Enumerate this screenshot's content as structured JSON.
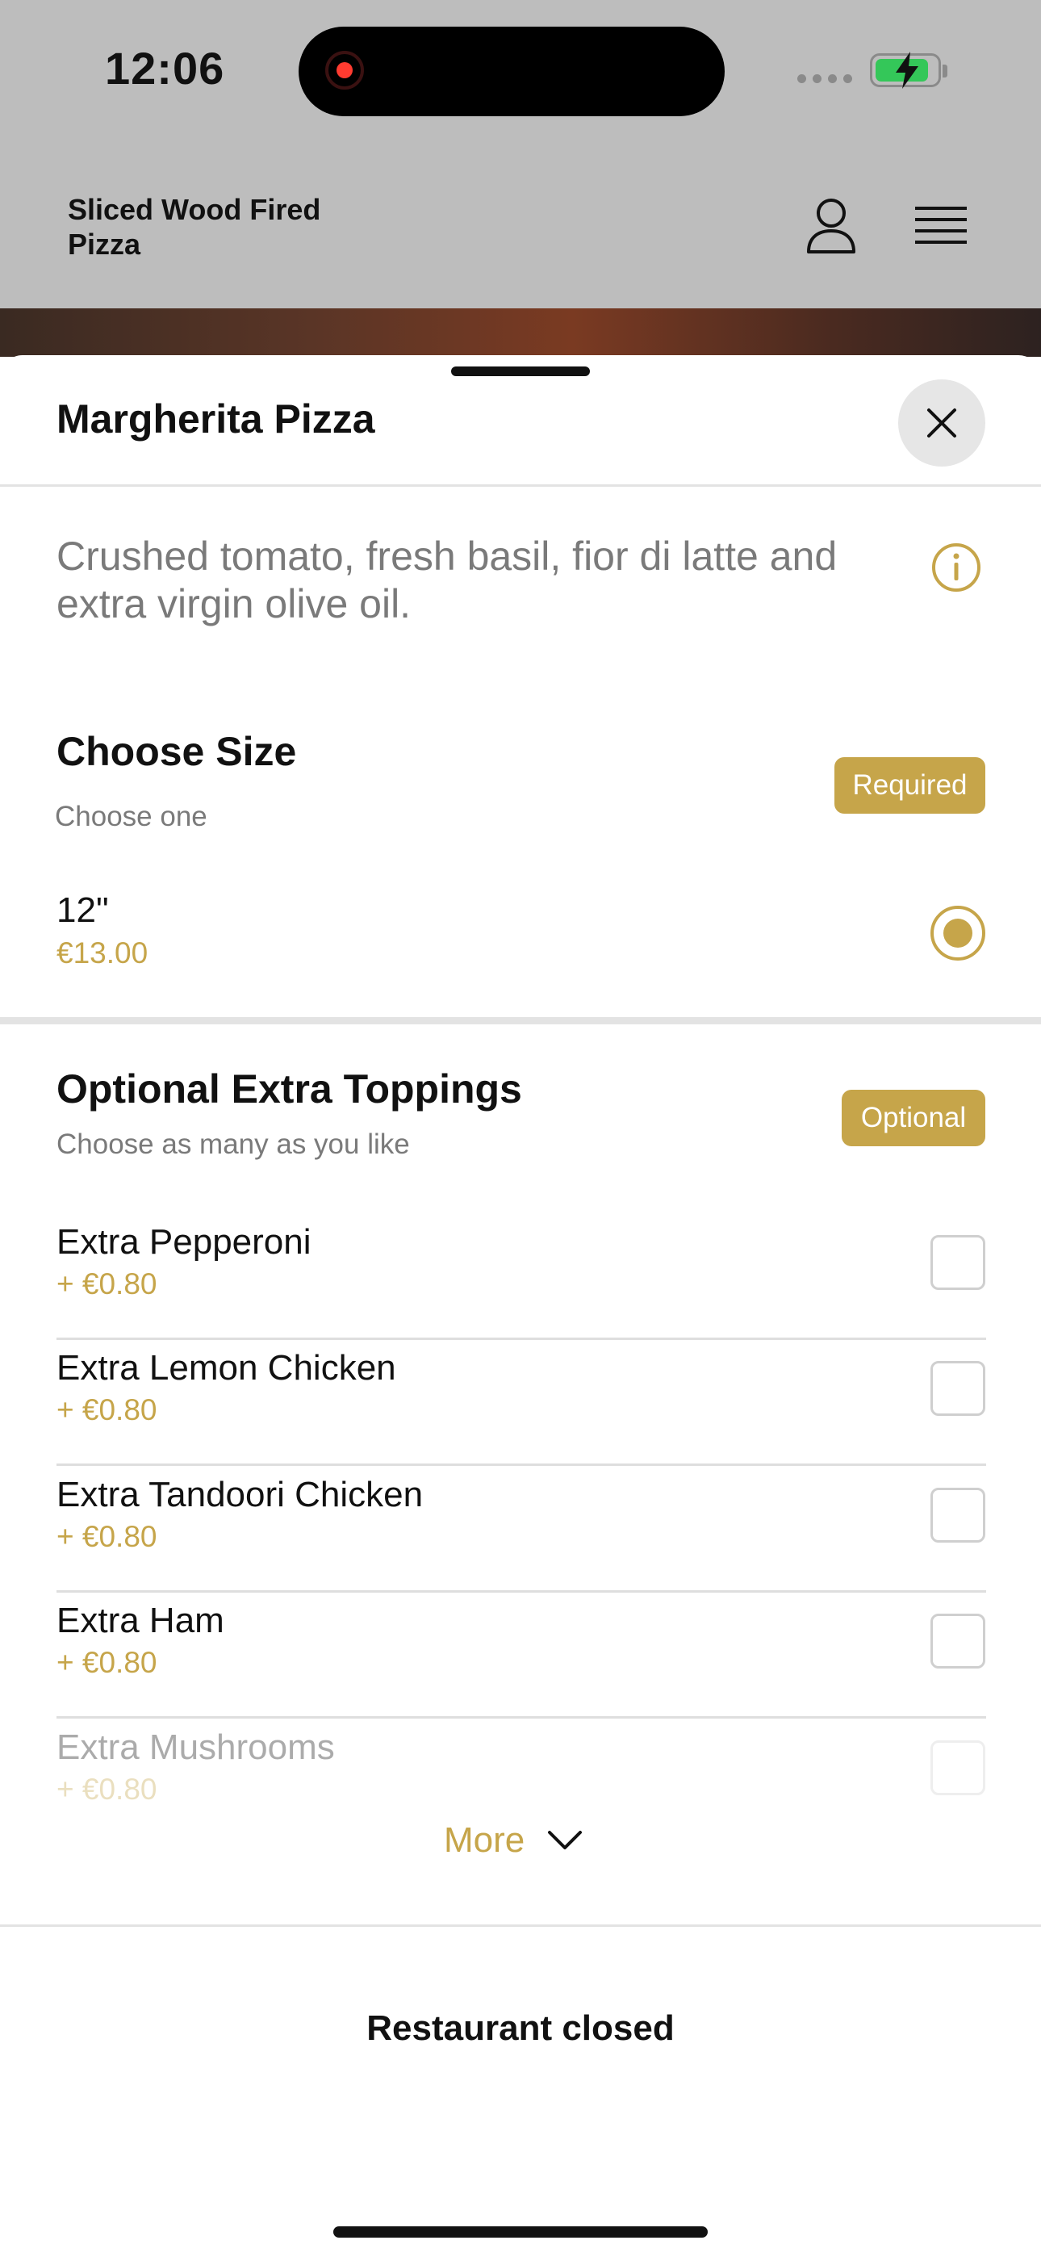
{
  "status_bar": {
    "time": "12:06",
    "battery_level": 0.85
  },
  "header": {
    "restaurant_name": "Sliced Wood Fired Pizza"
  },
  "item": {
    "title": "Margherita Pizza",
    "description": "Crushed tomato, fresh basil, fior di latte and extra virgin olive oil."
  },
  "size_section": {
    "title": "Choose Size",
    "subtitle": "Choose one",
    "badge": "Required",
    "options": [
      {
        "label": "12\"",
        "price": "€13.00",
        "selected": true
      }
    ]
  },
  "toppings_section": {
    "title": "Optional Extra Toppings",
    "subtitle": "Choose as many as you like",
    "badge": "Optional",
    "items": [
      {
        "name": "Extra Pepperoni",
        "price": "+ €0.80",
        "checked": false
      },
      {
        "name": "Extra Lemon Chicken",
        "price": "+ €0.80",
        "checked": false
      },
      {
        "name": "Extra Tandoori Chicken",
        "price": "+ €0.80",
        "checked": false
      },
      {
        "name": "Extra Ham",
        "price": "+ €0.80",
        "checked": false
      },
      {
        "name": "Extra Mushrooms",
        "price": "+ €0.80",
        "checked": false
      }
    ]
  },
  "more_label": "More",
  "footer": {
    "status": "Restaurant closed"
  },
  "colors": {
    "accent": "#c6a54a",
    "backdrop": "#bdbdbd",
    "battery": "#34c759"
  },
  "icons": [
    "account-icon",
    "menu-icon",
    "close-icon",
    "info-icon",
    "chevron-down-icon"
  ]
}
